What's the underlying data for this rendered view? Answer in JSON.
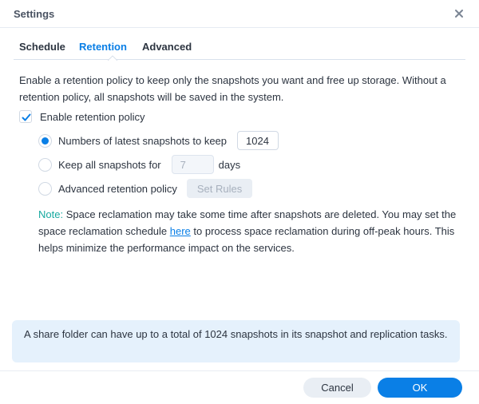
{
  "window": {
    "title": "Settings",
    "close_icon": "close-icon"
  },
  "tabs": [
    {
      "label": "Schedule",
      "active": false
    },
    {
      "label": "Retention",
      "active": true
    },
    {
      "label": "Advanced",
      "active": false
    }
  ],
  "retention": {
    "description": "Enable a retention policy to keep only the snapshots you want and free up storage. Without a retention policy, all snapshots will be saved in the system.",
    "enable_checkbox": {
      "label": "Enable retention policy",
      "checked": true
    },
    "options": [
      {
        "label": "Numbers of latest snapshots to keep",
        "checked": true,
        "input_value": "1024"
      },
      {
        "label": "Keep all snapshots for",
        "checked": false,
        "input_value": "7",
        "suffix": "days"
      },
      {
        "label": "Advanced retention policy",
        "checked": false,
        "button_label": "Set Rules"
      }
    ],
    "note": {
      "label": "Note:",
      "text_before_link": " Space reclamation may take some time after snapshots are deleted. You may set the space reclamation schedule ",
      "link_text": "here",
      "text_after_link": " to process space reclamation during off-peak hours. This helps minimize the performance impact on the services."
    },
    "info": "A share folder can have up to a total of 1024 snapshots in its snapshot and replication tasks."
  },
  "footer": {
    "cancel_label": "Cancel",
    "ok_label": "OK"
  },
  "colors": {
    "accent": "#0a7fe6",
    "note_label": "#17a9a0",
    "info_bg": "#e5f1fc"
  }
}
